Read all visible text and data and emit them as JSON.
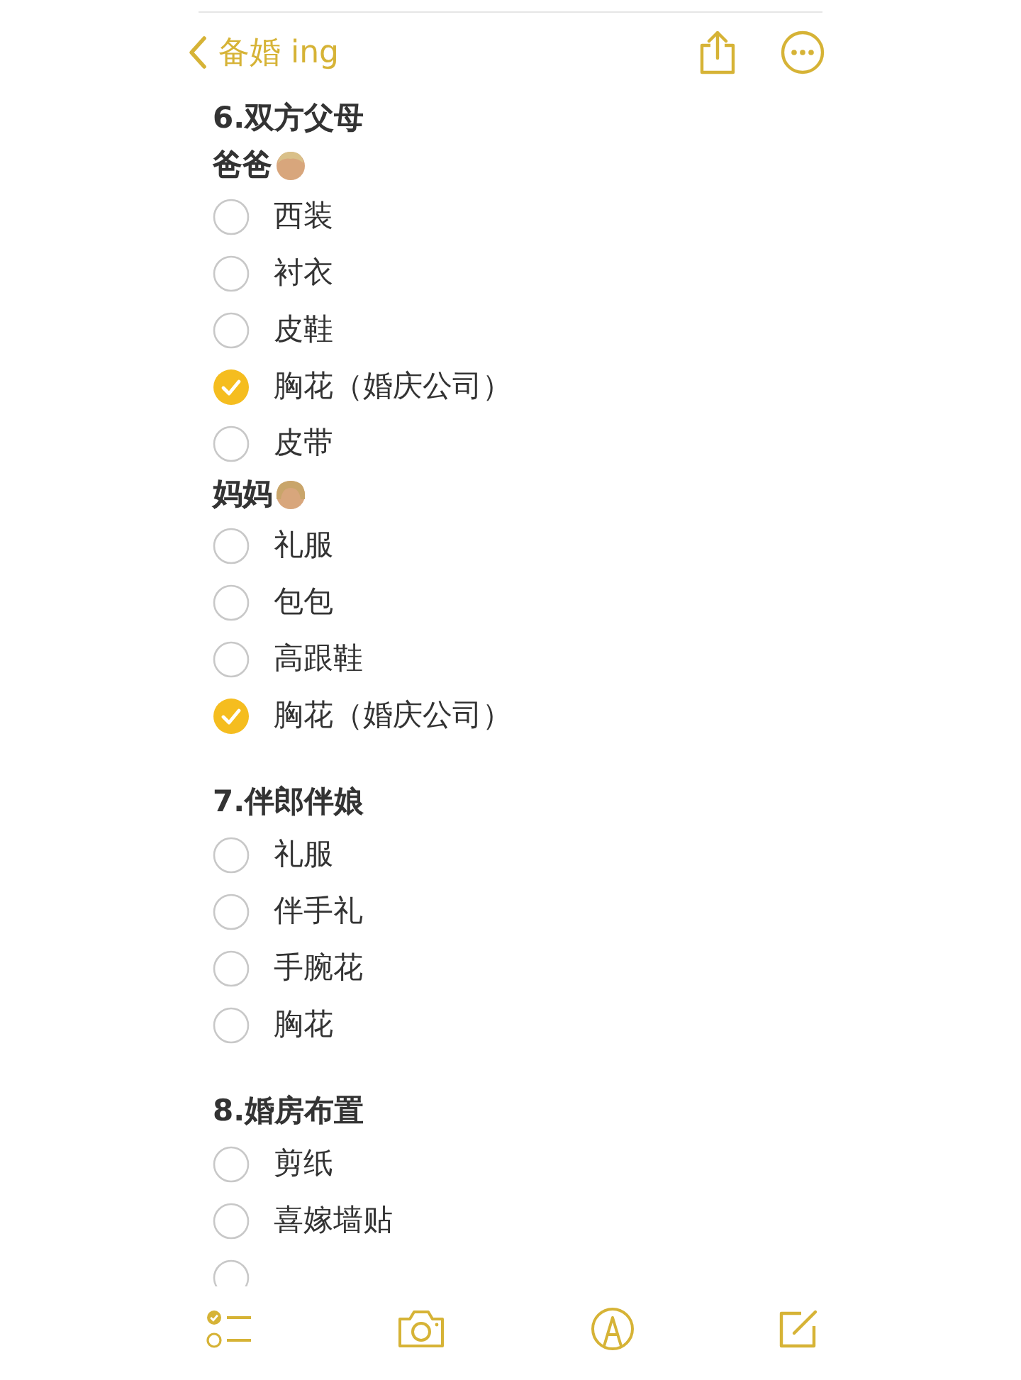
{
  "nav": {
    "back_label": "备婚 ing"
  },
  "lines": [
    {
      "kind": "heading",
      "text": "6.双方父母"
    },
    {
      "kind": "father",
      "text": "爸爸"
    },
    {
      "kind": "item",
      "text": "西装",
      "checked": false
    },
    {
      "kind": "item",
      "text": "衬衣",
      "checked": false
    },
    {
      "kind": "item",
      "text": "皮鞋",
      "checked": false
    },
    {
      "kind": "item",
      "text": "胸花（婚庆公司）",
      "checked": true
    },
    {
      "kind": "item",
      "text": "皮带",
      "checked": false
    },
    {
      "kind": "mother",
      "text": "妈妈"
    },
    {
      "kind": "item",
      "text": "礼服",
      "checked": false
    },
    {
      "kind": "item",
      "text": "包包",
      "checked": false
    },
    {
      "kind": "item",
      "text": "高跟鞋",
      "checked": false
    },
    {
      "kind": "item",
      "text": "胸花（婚庆公司）",
      "checked": true
    },
    {
      "kind": "heading",
      "text": "7.伴郎伴娘"
    },
    {
      "kind": "item",
      "text": "礼服",
      "checked": false
    },
    {
      "kind": "item",
      "text": "伴手礼",
      "checked": false
    },
    {
      "kind": "item",
      "text": "手腕花",
      "checked": false
    },
    {
      "kind": "item",
      "text": "胸花",
      "checked": false
    },
    {
      "kind": "heading",
      "text": "8.婚房布置"
    },
    {
      "kind": "item",
      "text": "剪纸",
      "checked": false
    },
    {
      "kind": "item",
      "text": "喜嫁墙贴",
      "checked": false
    },
    {
      "kind": "item",
      "checked": false
    }
  ]
}
